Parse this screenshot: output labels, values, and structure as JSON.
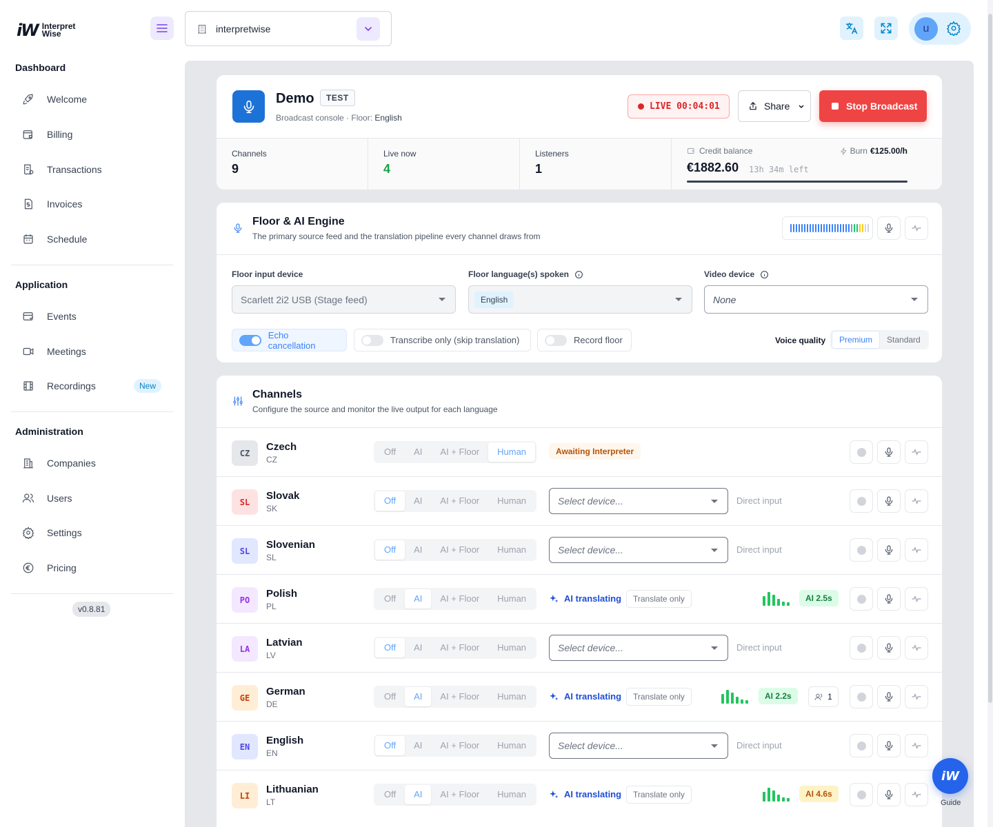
{
  "brand": {
    "mark": "iW",
    "line1": "Interpret",
    "line2": "Wise"
  },
  "org_select": {
    "value": "interpretwise"
  },
  "sidebar": {
    "sections": [
      {
        "title": "Dashboard",
        "items": [
          {
            "label": "Welcome",
            "icon": "rocket-icon"
          },
          {
            "label": "Billing",
            "icon": "wallet-icon"
          },
          {
            "label": "Transactions",
            "icon": "receipt-icon"
          },
          {
            "label": "Invoices",
            "icon": "invoice-icon"
          },
          {
            "label": "Schedule",
            "icon": "calendar-icon"
          }
        ]
      },
      {
        "title": "Application",
        "items": [
          {
            "label": "Events",
            "icon": "event-icon"
          },
          {
            "label": "Meetings",
            "icon": "video-icon"
          },
          {
            "label": "Recordings",
            "icon": "film-icon",
            "badge": "New"
          }
        ]
      },
      {
        "title": "Administration",
        "items": [
          {
            "label": "Companies",
            "icon": "building-icon"
          },
          {
            "label": "Users",
            "icon": "users-icon"
          },
          {
            "label": "Settings",
            "icon": "gear-icon"
          },
          {
            "label": "Pricing",
            "icon": "euro-icon"
          }
        ]
      }
    ],
    "version": "v0.8.81"
  },
  "user": {
    "initial": "u"
  },
  "header": {
    "title": "Demo",
    "tag": "TEST",
    "subtitle_prefix": "Broadcast console · Floor:",
    "subtitle_floor": "English",
    "live_label": "LIVE",
    "live_time": "00:04:01",
    "share_label": "Share",
    "stop_label": "Stop Broadcast"
  },
  "stats": {
    "channels_label": "Channels",
    "channels_value": "9",
    "live_label": "Live now",
    "live_value": "4",
    "listeners_label": "Listeners",
    "listeners_value": "1",
    "credit_label": "Credit balance",
    "burn_label": "Burn",
    "burn_value": "€125.00/h",
    "credit_value": "€1882.60",
    "credit_left": "13h 34m left",
    "credit_fraction": 1.0
  },
  "floor": {
    "title": "Floor & AI Engine",
    "subtitle": "The primary source feed and the translation pipeline every channel draws from",
    "input_label": "Floor input device",
    "input_value": "Scarlett 2i2 USB (Stage feed)",
    "lang_label": "Floor language(s) spoken",
    "lang_value": "English",
    "video_label": "Video device",
    "video_value": "None",
    "toggles": [
      {
        "label": "Echo cancellation",
        "on": true
      },
      {
        "label": "Transcribe only (skip translation)",
        "on": false
      },
      {
        "label": "Record floor",
        "on": false
      }
    ],
    "vq_label": "Voice quality",
    "vq_options": [
      "Premium",
      "Standard"
    ],
    "vq_selected": "Premium"
  },
  "channels": {
    "title": "Channels",
    "subtitle": "Configure the source and monitor the live output for each language",
    "mode_options": [
      "Off",
      "AI",
      "AI + Floor",
      "Human"
    ],
    "select_placeholder": "Select device...",
    "direct_label": "Direct input",
    "ai_label": "AI translating",
    "translate_only_label": "Translate only",
    "awaiting_label": "Awaiting Interpreter",
    "rows": [
      {
        "abbr": "CZ",
        "name": "Czech",
        "code": "CZ",
        "mode": "Human",
        "flag_bg": "#e5e7eb",
        "flag_fg": "#4b5563",
        "status": "awaiting"
      },
      {
        "abbr": "SL",
        "name": "Slovak",
        "code": "SK",
        "mode": "Off",
        "flag_bg": "#fee2e2",
        "flag_fg": "#dc2626",
        "status": "device"
      },
      {
        "abbr": "SL",
        "name": "Slovenian",
        "code": "SL",
        "mode": "Off",
        "flag_bg": "#e0e7ff",
        "flag_fg": "#4f46e5",
        "status": "device"
      },
      {
        "abbr": "PO",
        "name": "Polish",
        "code": "PL",
        "mode": "AI",
        "flag_bg": "#f3e8ff",
        "flag_fg": "#9333ea",
        "status": "ai",
        "latency": "AI 2.5s",
        "latency_tone": "green"
      },
      {
        "abbr": "LA",
        "name": "Latvian",
        "code": "LV",
        "mode": "Off",
        "flag_bg": "#f3e8ff",
        "flag_fg": "#9333ea",
        "status": "device"
      },
      {
        "abbr": "GE",
        "name": "German",
        "code": "DE",
        "mode": "AI",
        "flag_bg": "#ffedd5",
        "flag_fg": "#c2410c",
        "status": "ai",
        "latency": "AI 2.2s",
        "latency_tone": "green",
        "listeners": "1"
      },
      {
        "abbr": "EN",
        "name": "English",
        "code": "EN",
        "mode": "Off",
        "flag_bg": "#e0e7ff",
        "flag_fg": "#4f46e5",
        "status": "device"
      },
      {
        "abbr": "LI",
        "name": "Lithuanian",
        "code": "LT",
        "mode": "AI",
        "flag_bg": "#ffedd5",
        "flag_fg": "#c2410c",
        "status": "ai",
        "latency": "AI 4.6s",
        "latency_tone": "amber"
      }
    ]
  },
  "guide": {
    "mark": "iW",
    "label": "Guide"
  }
}
